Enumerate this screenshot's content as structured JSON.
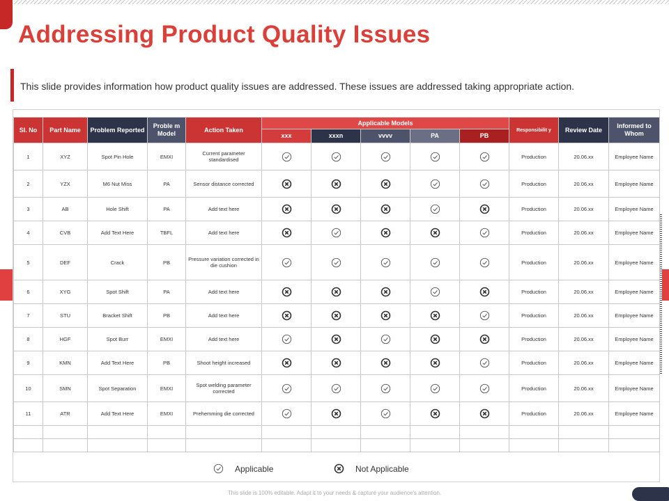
{
  "title": "Addressing Product Quality Issues",
  "subtitle": "This slide provides information how product quality issues are addressed. These issues are addressed taking appropriate action.",
  "table": {
    "headers": {
      "sl_no": "Sl. No",
      "part_name": "Part Name",
      "problem_reported": "Problem Reported",
      "problem_model": "Proble m Model",
      "action_taken": "Action Taken",
      "applicable_models": "Applicable Models",
      "models": [
        "xxx",
        "xxxn",
        "vvvv",
        "PA",
        "PB"
      ],
      "responsibility": "Responsibilit y",
      "review_date": "Review Date",
      "informed_to_whom": "Informed to Whom"
    },
    "rows": [
      {
        "no": "1",
        "part": "XYZ",
        "problem": "Spot Pin Hole",
        "model": "EMXI",
        "action": "Current parameter standardised",
        "status": [
          "check",
          "check",
          "check",
          "check",
          "check"
        ],
        "resp": "Production",
        "date": "20.06.xx",
        "informed": "Employee Name"
      },
      {
        "no": "2",
        "part": "YZX",
        "problem": "M6 Nut Miss",
        "model": "PA",
        "action": "Sensor distance corrected",
        "status": [
          "cross",
          "cross",
          "cross",
          "check",
          "check"
        ],
        "resp": "Production",
        "date": "20.06.xx",
        "informed": "Employee Name"
      },
      {
        "no": "3",
        "part": "AB",
        "problem": "Hole Shift",
        "model": "PA",
        "action": "Add text here",
        "status": [
          "cross",
          "cross",
          "cross",
          "check",
          "cross"
        ],
        "resp": "Production",
        "date": "20.06.xx",
        "informed": "Employee Name"
      },
      {
        "no": "4",
        "part": "CVB",
        "problem": "Add Text Here",
        "model": "TBFL",
        "action": "Add text here",
        "status": [
          "cross",
          "check",
          "cross",
          "cross",
          "check"
        ],
        "resp": "Production",
        "date": "20.06.xx",
        "informed": "Employee Name"
      },
      {
        "no": "5",
        "part": "DEF",
        "problem": "Crack",
        "model": "PB",
        "action": "Pressure variation corrected in die cushion",
        "status": [
          "check",
          "check",
          "check",
          "check",
          "check"
        ],
        "resp": "Production",
        "date": "20.06.xx",
        "informed": "Employee Name"
      },
      {
        "no": "6",
        "part": "XYG",
        "problem": "Spot Shift",
        "model": "PA",
        "action": "Add text here",
        "status": [
          "cross",
          "cross",
          "cross",
          "check",
          "cross"
        ],
        "resp": "Production",
        "date": "20.06.xx",
        "informed": "Employee Name"
      },
      {
        "no": "7",
        "part": "STU",
        "problem": "Bracket Shift",
        "model": "PB",
        "action": "Add text here",
        "status": [
          "cross",
          "cross",
          "cross",
          "cross",
          "check"
        ],
        "resp": "Production",
        "date": "20.06.xx",
        "informed": "Employee Name"
      },
      {
        "no": "8",
        "part": "HGF",
        "problem": "Spot Burr",
        "model": "EMXI",
        "action": "Add text here",
        "status": [
          "check",
          "cross",
          "check",
          "cross",
          "cross"
        ],
        "resp": "Production",
        "date": "20.06.xx",
        "informed": "Employee Name"
      },
      {
        "no": "9",
        "part": "KMN",
        "problem": "Add Text Here",
        "model": "PB",
        "action": "Shoot height increased",
        "status": [
          "cross",
          "cross",
          "cross",
          "cross",
          "check"
        ],
        "resp": "Production",
        "date": "20.06.xx",
        "informed": "Employee Name"
      },
      {
        "no": "10",
        "part": "SMN",
        "problem": "Spot Separation",
        "model": "EMXI",
        "action": "Spot welding parameter corrected",
        "status": [
          "check",
          "check",
          "check",
          "check",
          "check"
        ],
        "resp": "Production",
        "date": "20.06.xx",
        "informed": "Employee Name"
      },
      {
        "no": "11",
        "part": "ATR",
        "problem": "Add Text Here",
        "model": "EMXI",
        "action": "Prehemming die corrected",
        "status": [
          "check",
          "cross",
          "check",
          "cross",
          "cross"
        ],
        "resp": "Production",
        "date": "20.06.xx",
        "informed": "Employee Name"
      }
    ]
  },
  "legend": {
    "applicable": "Applicable",
    "not_applicable": "Not Applicable"
  },
  "footer": "This slide is 100% editable. Adapt it to your needs & capture your audience's attention.",
  "colors": {
    "accent_red": "#d9403a",
    "header_dark": "#2d3349",
    "header_slate": "#4d536b"
  }
}
